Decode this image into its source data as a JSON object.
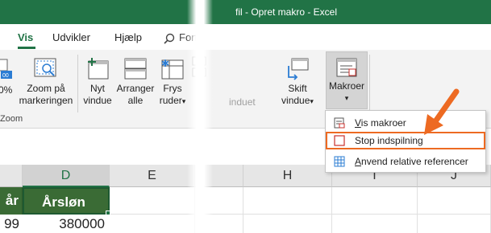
{
  "window": {
    "title": "fil - Opret makro  -  Excel"
  },
  "tabs": [
    {
      "label": "Vis",
      "active": true
    },
    {
      "label": "Udvikler",
      "active": false
    },
    {
      "label": "Hjælp",
      "active": false
    }
  ],
  "search": {
    "label": "Fort"
  },
  "ribbon": {
    "zoom_100_label": "0%",
    "zoom_selection_label": [
      "Zoom på",
      "markeringen"
    ],
    "zoom_group_label": "Zoom",
    "new_window_label": [
      "Nyt",
      "vindue"
    ],
    "arrange_all_label": [
      "Arranger",
      "alle"
    ],
    "freeze_panes_label": [
      "Frys",
      "ruder"
    ],
    "faded_label": "induet",
    "switch_windows_label": [
      "Skift",
      "vindue"
    ],
    "macros_label": "Makroer",
    "dropdown_arrow": "▾"
  },
  "macro_menu": {
    "items": [
      {
        "label": "Vis makroer",
        "underline_char": "V",
        "rest": "is makroer",
        "highlighted": false
      },
      {
        "label": "Stop indspilning",
        "underline_char": "",
        "rest": "Stop indspilning",
        "highlighted": true
      },
      {
        "label": "Anvend relative referencer",
        "underline_char": "A",
        "rest": "nvend relative referencer",
        "highlighted": false
      }
    ]
  },
  "colors": {
    "excel_green": "#217346",
    "header_fill": "#3a6b35",
    "highlight_orange": "#ed6a22"
  },
  "grid": {
    "columns": [
      "D",
      "E",
      "H",
      "I",
      "J"
    ],
    "header_row": {
      "partial_left": "år",
      "D": "Årsløn"
    },
    "data_row": {
      "partial_left": "99",
      "D": "380000"
    }
  }
}
